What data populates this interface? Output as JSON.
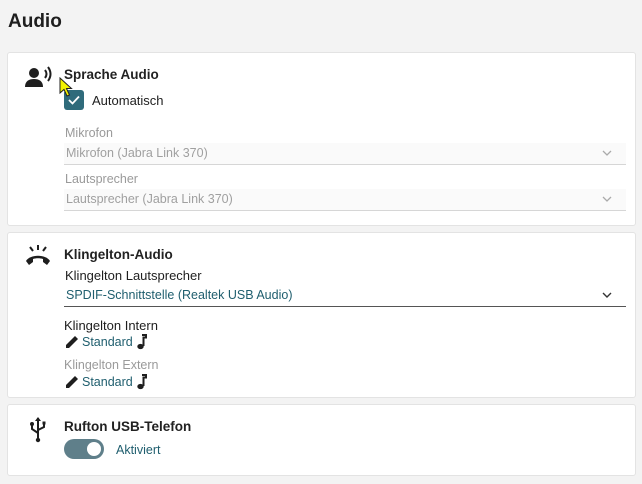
{
  "page": {
    "title": "Audio"
  },
  "speech_audio": {
    "title": "Sprache Audio",
    "automatic_label": "Automatisch",
    "automatic_checked": true,
    "microphone_label": "Mikrofon",
    "microphone_value": "Mikrofon (Jabra Link 370)",
    "speaker_label": "Lautsprecher",
    "speaker_value": "Lautsprecher (Jabra Link 370)"
  },
  "ringtone_audio": {
    "title": "Klingelton-Audio",
    "speaker_label": "Klingelton Lautsprecher",
    "speaker_value": "SPDIF-Schnittstelle (Realtek USB Audio)",
    "internal_label": "Klingelton Intern",
    "internal_value": "Standard",
    "external_label": "Klingelton Extern",
    "external_value": "Standard"
  },
  "usb_phone": {
    "title": "Rufton USB-Telefon",
    "toggle_state": "on",
    "toggle_label": "Aktiviert"
  },
  "colors": {
    "accent": "#1f5e6e",
    "checkbox": "#2f6b7b",
    "toggle": "#5f7f8a"
  },
  "icons": {
    "speech": "person-speaking-icon",
    "ringtone": "ringing-phone-icon",
    "usb": "usb-icon",
    "edit": "pencil-icon",
    "note": "music-note-icon",
    "dropdown": "chevron-down-icon"
  }
}
